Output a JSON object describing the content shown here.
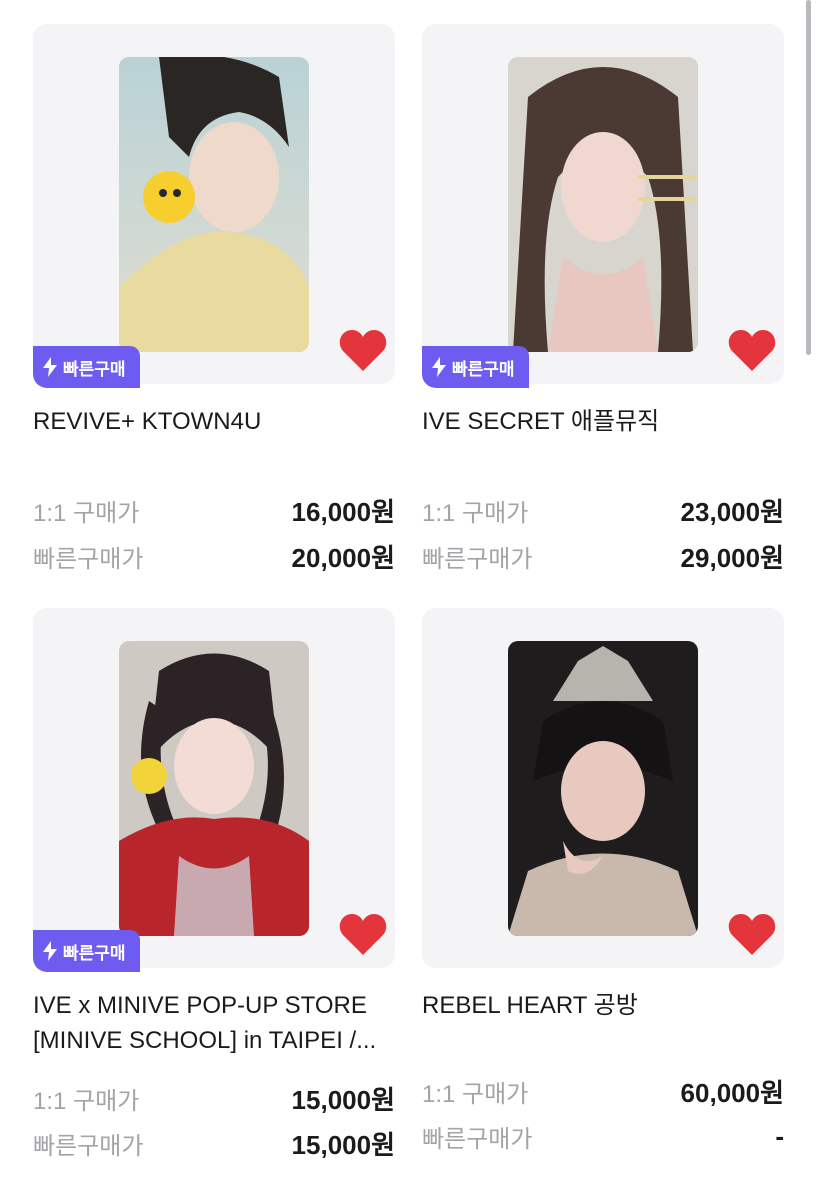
{
  "colors": {
    "badge": "#6e5cf0",
    "heart": "#e5353c",
    "card_bg": "#f4f3f5",
    "label": "#a4a4a8"
  },
  "icons": {
    "badge": "lightning-bolt-icon",
    "like": "heart-icon"
  },
  "labels": {
    "one_to_one": "1:1 구매가",
    "quick_buy_price": "빠른구매가",
    "badge": "빠른구매"
  },
  "products": [
    {
      "title": "REVIVE+ KTOWN4U",
      "has_badge": true,
      "price_1to1": "16,000원",
      "price_quick": "20,000원"
    },
    {
      "title": "IVE SECRET 애플뮤직",
      "has_badge": true,
      "price_1to1": "23,000원",
      "price_quick": "29,000원"
    },
    {
      "title": "IVE x MINIVE POP-UP STORE [MINIVE SCHOOL] in TAIPEI /...",
      "has_badge": true,
      "price_1to1": "15,000원",
      "price_quick": "15,000원"
    },
    {
      "title": "REBEL HEART 공방",
      "has_badge": false,
      "price_1to1": "60,000원",
      "price_quick": "-"
    }
  ]
}
